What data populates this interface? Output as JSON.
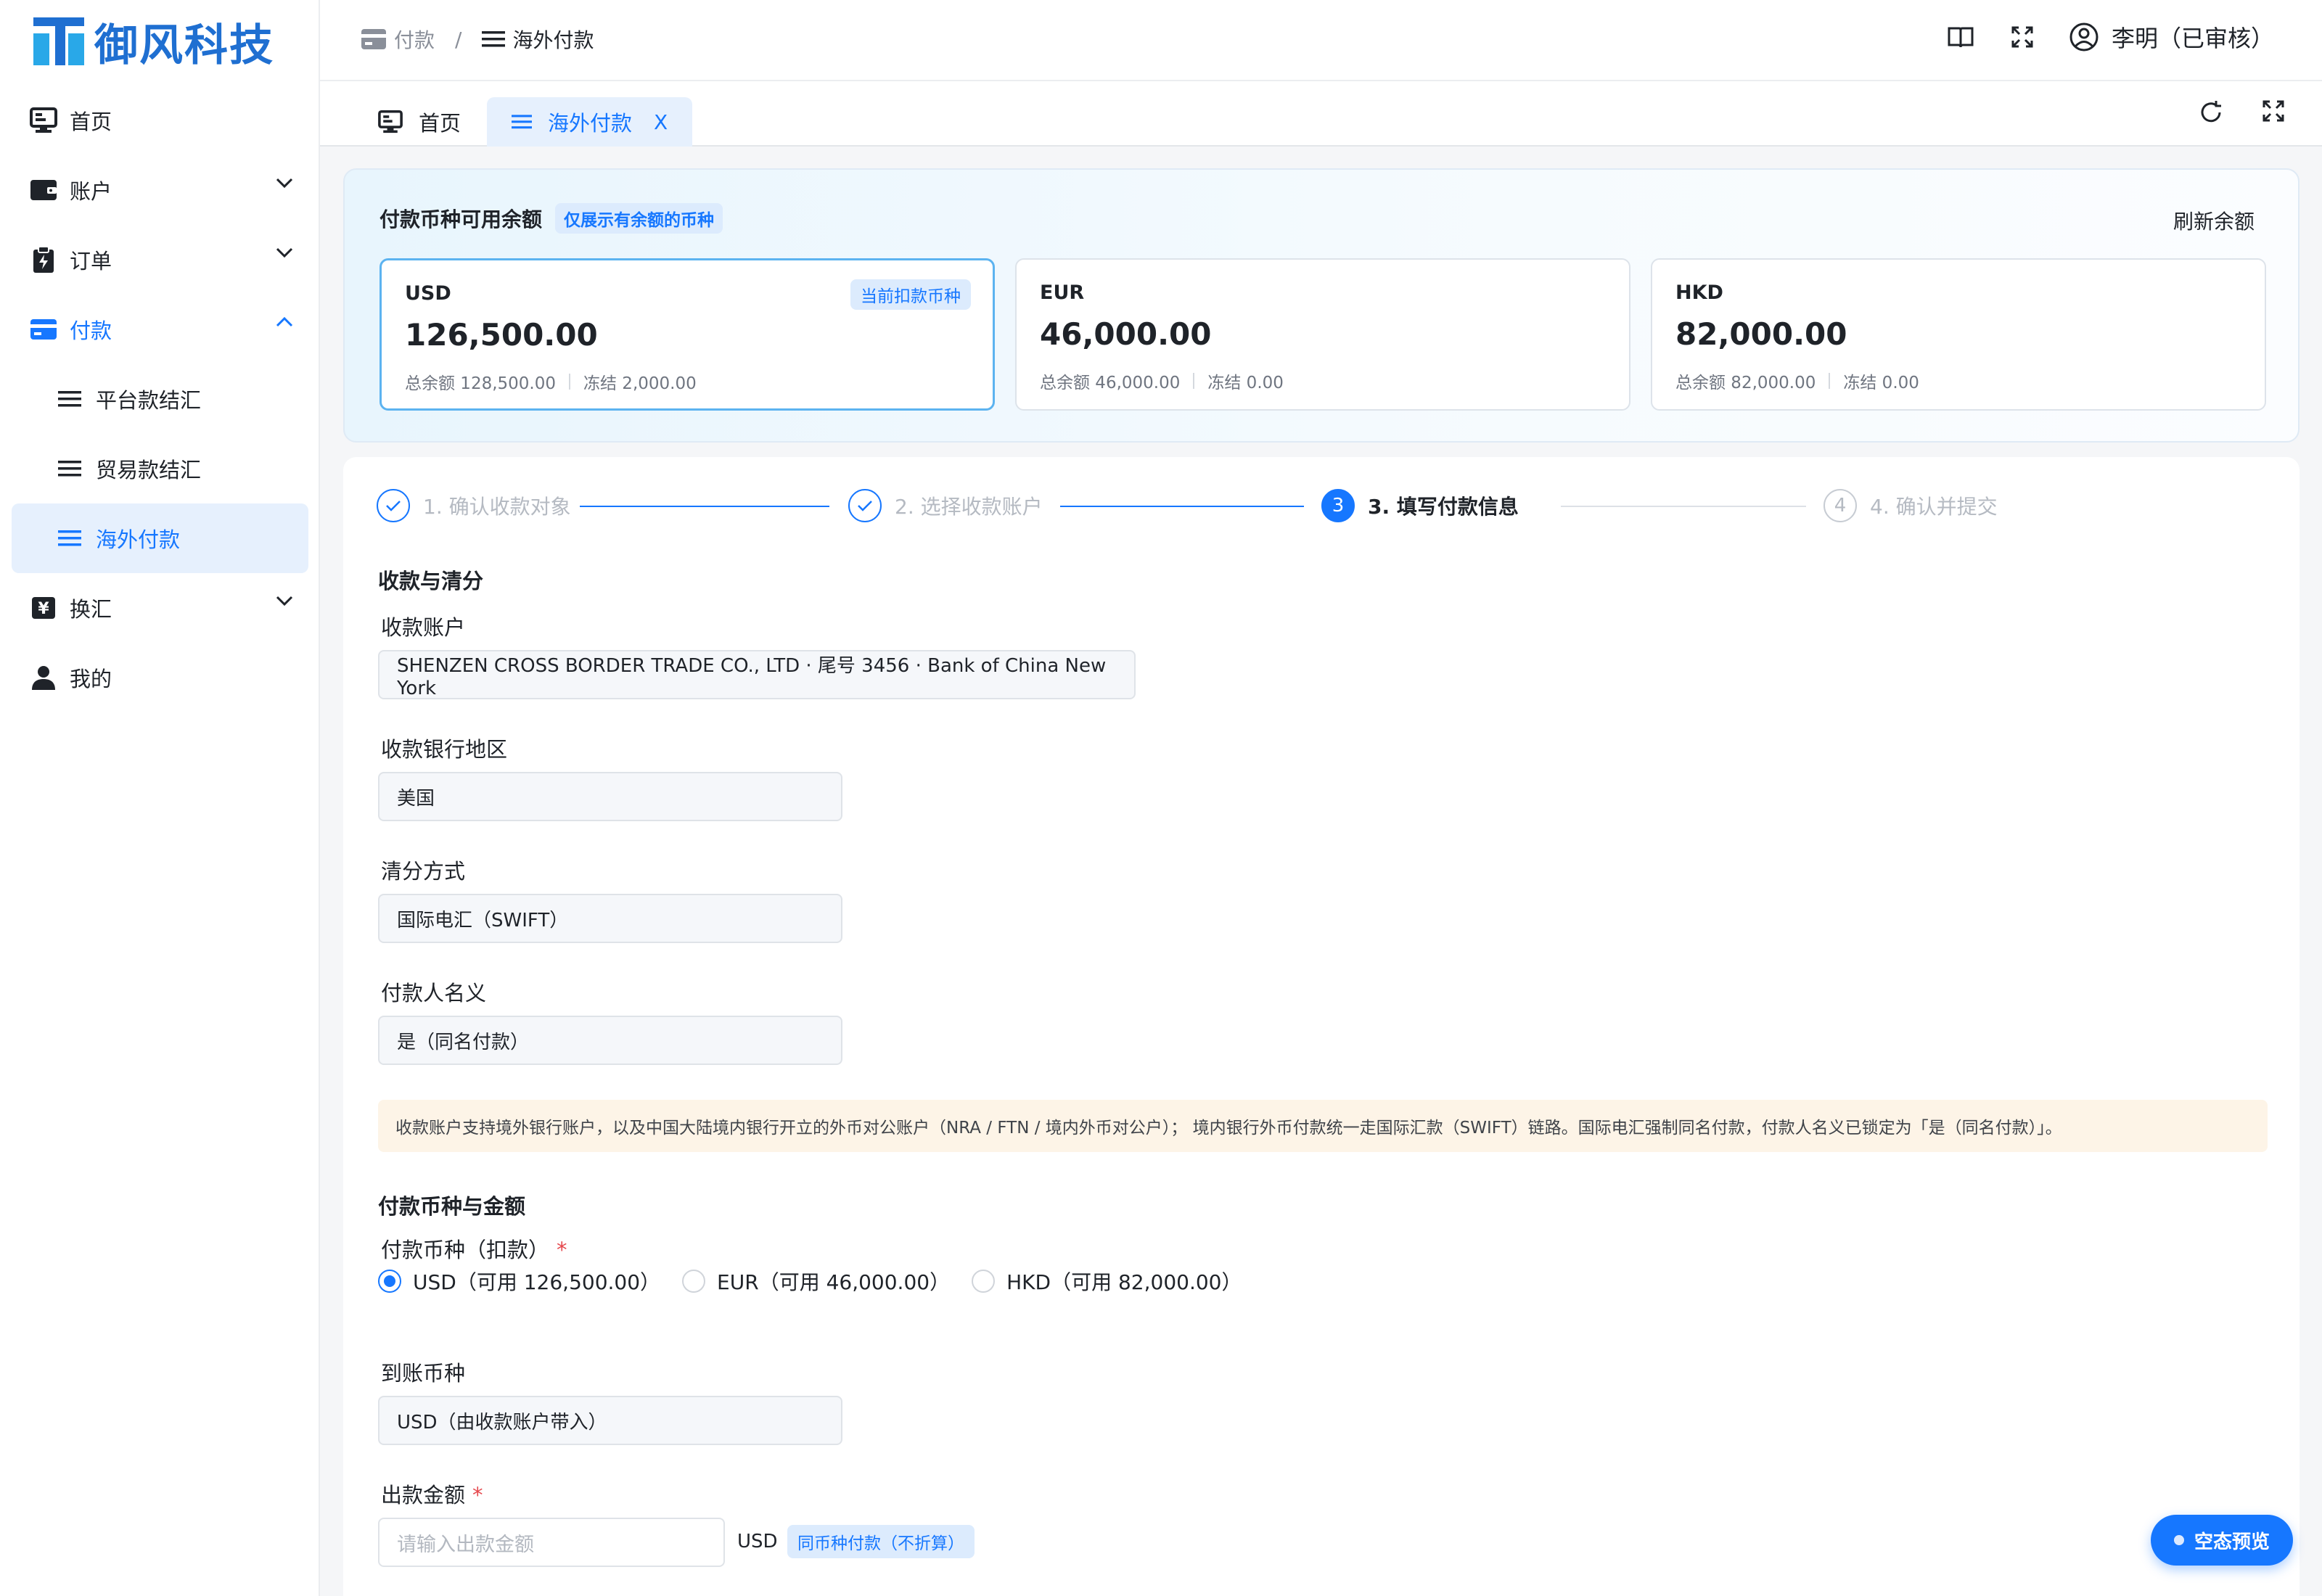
{
  "brand": {
    "name": "御风科技"
  },
  "sidebar": {
    "items": [
      {
        "label": "首页"
      },
      {
        "label": "账户"
      },
      {
        "label": "订单"
      },
      {
        "label": "付款"
      },
      {
        "label": "平台款结汇"
      },
      {
        "label": "贸易款结汇"
      },
      {
        "label": "海外付款"
      },
      {
        "label": "换汇"
      },
      {
        "label": "我的"
      }
    ]
  },
  "breadcrumb": {
    "parent": "付款",
    "separator": "/",
    "current": "海外付款"
  },
  "header": {
    "user": "李明（已审核）"
  },
  "tabs": [
    {
      "label": "首页"
    },
    {
      "label": "海外付款",
      "close": "X"
    }
  ],
  "balance": {
    "title": "付款币种可用余额",
    "tag": "仅展示有余额的币种",
    "refresh": "刷新余额",
    "currencies": [
      {
        "code": "USD",
        "amount": "126,500.00",
        "total": "总余额 128,500.00",
        "frozen": "冻结 2,000.00",
        "badge": "当前扣款币种"
      },
      {
        "code": "EUR",
        "amount": "46,000.00",
        "total": "总余额 46,000.00",
        "frozen": "冻结 0.00"
      },
      {
        "code": "HKD",
        "amount": "82,000.00",
        "total": "总余额 82,000.00",
        "frozen": "冻结 0.00"
      }
    ]
  },
  "steps": [
    {
      "label": "1. 确认收款对象",
      "state": "done"
    },
    {
      "label": "2. 选择收款账户",
      "state": "done"
    },
    {
      "label": "3. 填写付款信息",
      "num": "3",
      "state": "current"
    },
    {
      "label": "4. 确认并提交",
      "num": "4",
      "state": "todo"
    }
  ],
  "form": {
    "section1": "收款与清分",
    "account_label": "收款账户",
    "account_value": "SHENZEN CROSS BORDER TRADE CO., LTD · 尾号 3456 · Bank of China New York",
    "region_label": "收款银行地区",
    "region_value": "美国",
    "clearing_label": "清分方式",
    "clearing_value": "国际电汇（SWIFT）",
    "payer_label": "付款人名义",
    "payer_value": "是（同名付款）",
    "notice": "收款账户支持境外银行账户，以及中国大陆境内银行开立的外币对公账户（NRA / FTN / 境内外币对公户）； 境内银行外币付款统一走国际汇款（SWIFT）链路。国际电汇强制同名付款，付款人名义已锁定为「是（同名付款）」。",
    "section2": "付款币种与金额",
    "pay_currency_label": "付款币种（扣款）",
    "required_mark": "*",
    "pay_options": [
      {
        "label": "USD（可用 126,500.00）",
        "selected": true
      },
      {
        "label": "EUR（可用 46,000.00）",
        "selected": false
      },
      {
        "label": "HKD（可用 82,000.00）",
        "selected": false
      }
    ],
    "receive_currency_label": "到账币种",
    "receive_currency_value": "USD（由收款账户带入）",
    "amount_label": "出款金额",
    "amount_placeholder": "请输入出款金额",
    "amount_unit": "USD",
    "amount_tag": "同币种付款（不折算）"
  },
  "fab": {
    "label": "空态预览"
  },
  "colors": {
    "primary": "#1677ff",
    "brand": "#1f6fd1",
    "notice_bg": "#fdf4e7",
    "active_bg": "#e6f0fd"
  }
}
